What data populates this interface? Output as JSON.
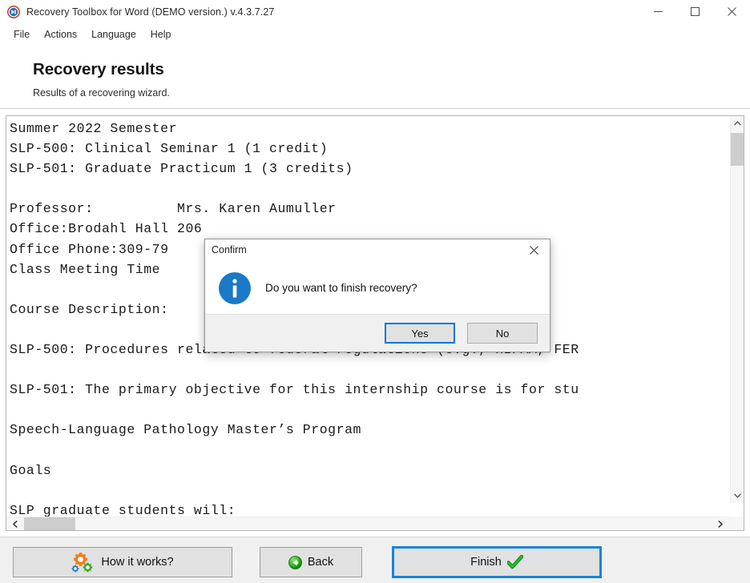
{
  "window": {
    "title": "Recovery Toolbox for Word (DEMO version.) v.4.3.7.27",
    "icon": "app-logo-icon",
    "controls": {
      "minimize": "—",
      "maximize": "☐",
      "close": "✕"
    }
  },
  "menu": {
    "items": [
      {
        "label": "File"
      },
      {
        "label": "Actions"
      },
      {
        "label": "Language"
      },
      {
        "label": "Help"
      }
    ]
  },
  "header": {
    "title": "Recovery results",
    "subtitle": "Results of a recovering wizard."
  },
  "results": {
    "text": "Summer 2022 Semester\nSLP-500: Clinical Seminar 1 (1 credit)\nSLP-501: Graduate Practicum 1 (3 credits)\n\nProfessor:          Mrs. Karen Aumuller\nOffice:Brodahl Hall 206\nOffice Phone:309-79                       \nClass Meeting Time                        5 am in Brodahl 2\n\nCourse Description:\n\nSLP-500: Procedures related to federal regulations (e.g., HIPAA, FER\n\nSLP-501: The primary objective for this internship course is for stu\n\nSpeech-Language Pathology Master’s Program\n\nGoals\n\nSLP graduate students will:",
    "vscroll": {
      "up_arrow": "scroll-up-icon",
      "down_arrow": "scroll-down-icon"
    },
    "hscroll": {
      "left_arrow": "scroll-left-icon",
      "right_arrow": "scroll-right-icon"
    }
  },
  "footer": {
    "how_it_works": "How it works?",
    "back": "Back",
    "finish": "Finish"
  },
  "dialog": {
    "title": "Confirm",
    "message": "Do you want to finish recovery?",
    "icon": "info-icon",
    "close": "✕",
    "yes": "Yes",
    "no": "No"
  },
  "colors": {
    "accent_blue": "#0078d7",
    "focus_blue": "#1484dd",
    "info_blue": "#1a7ac7",
    "gear_orange": "#f07d1a",
    "gear_green": "#3fa82e",
    "gear_blue": "#2b7fd1",
    "check_green": "#1faf31",
    "back_green": "#17a412"
  }
}
